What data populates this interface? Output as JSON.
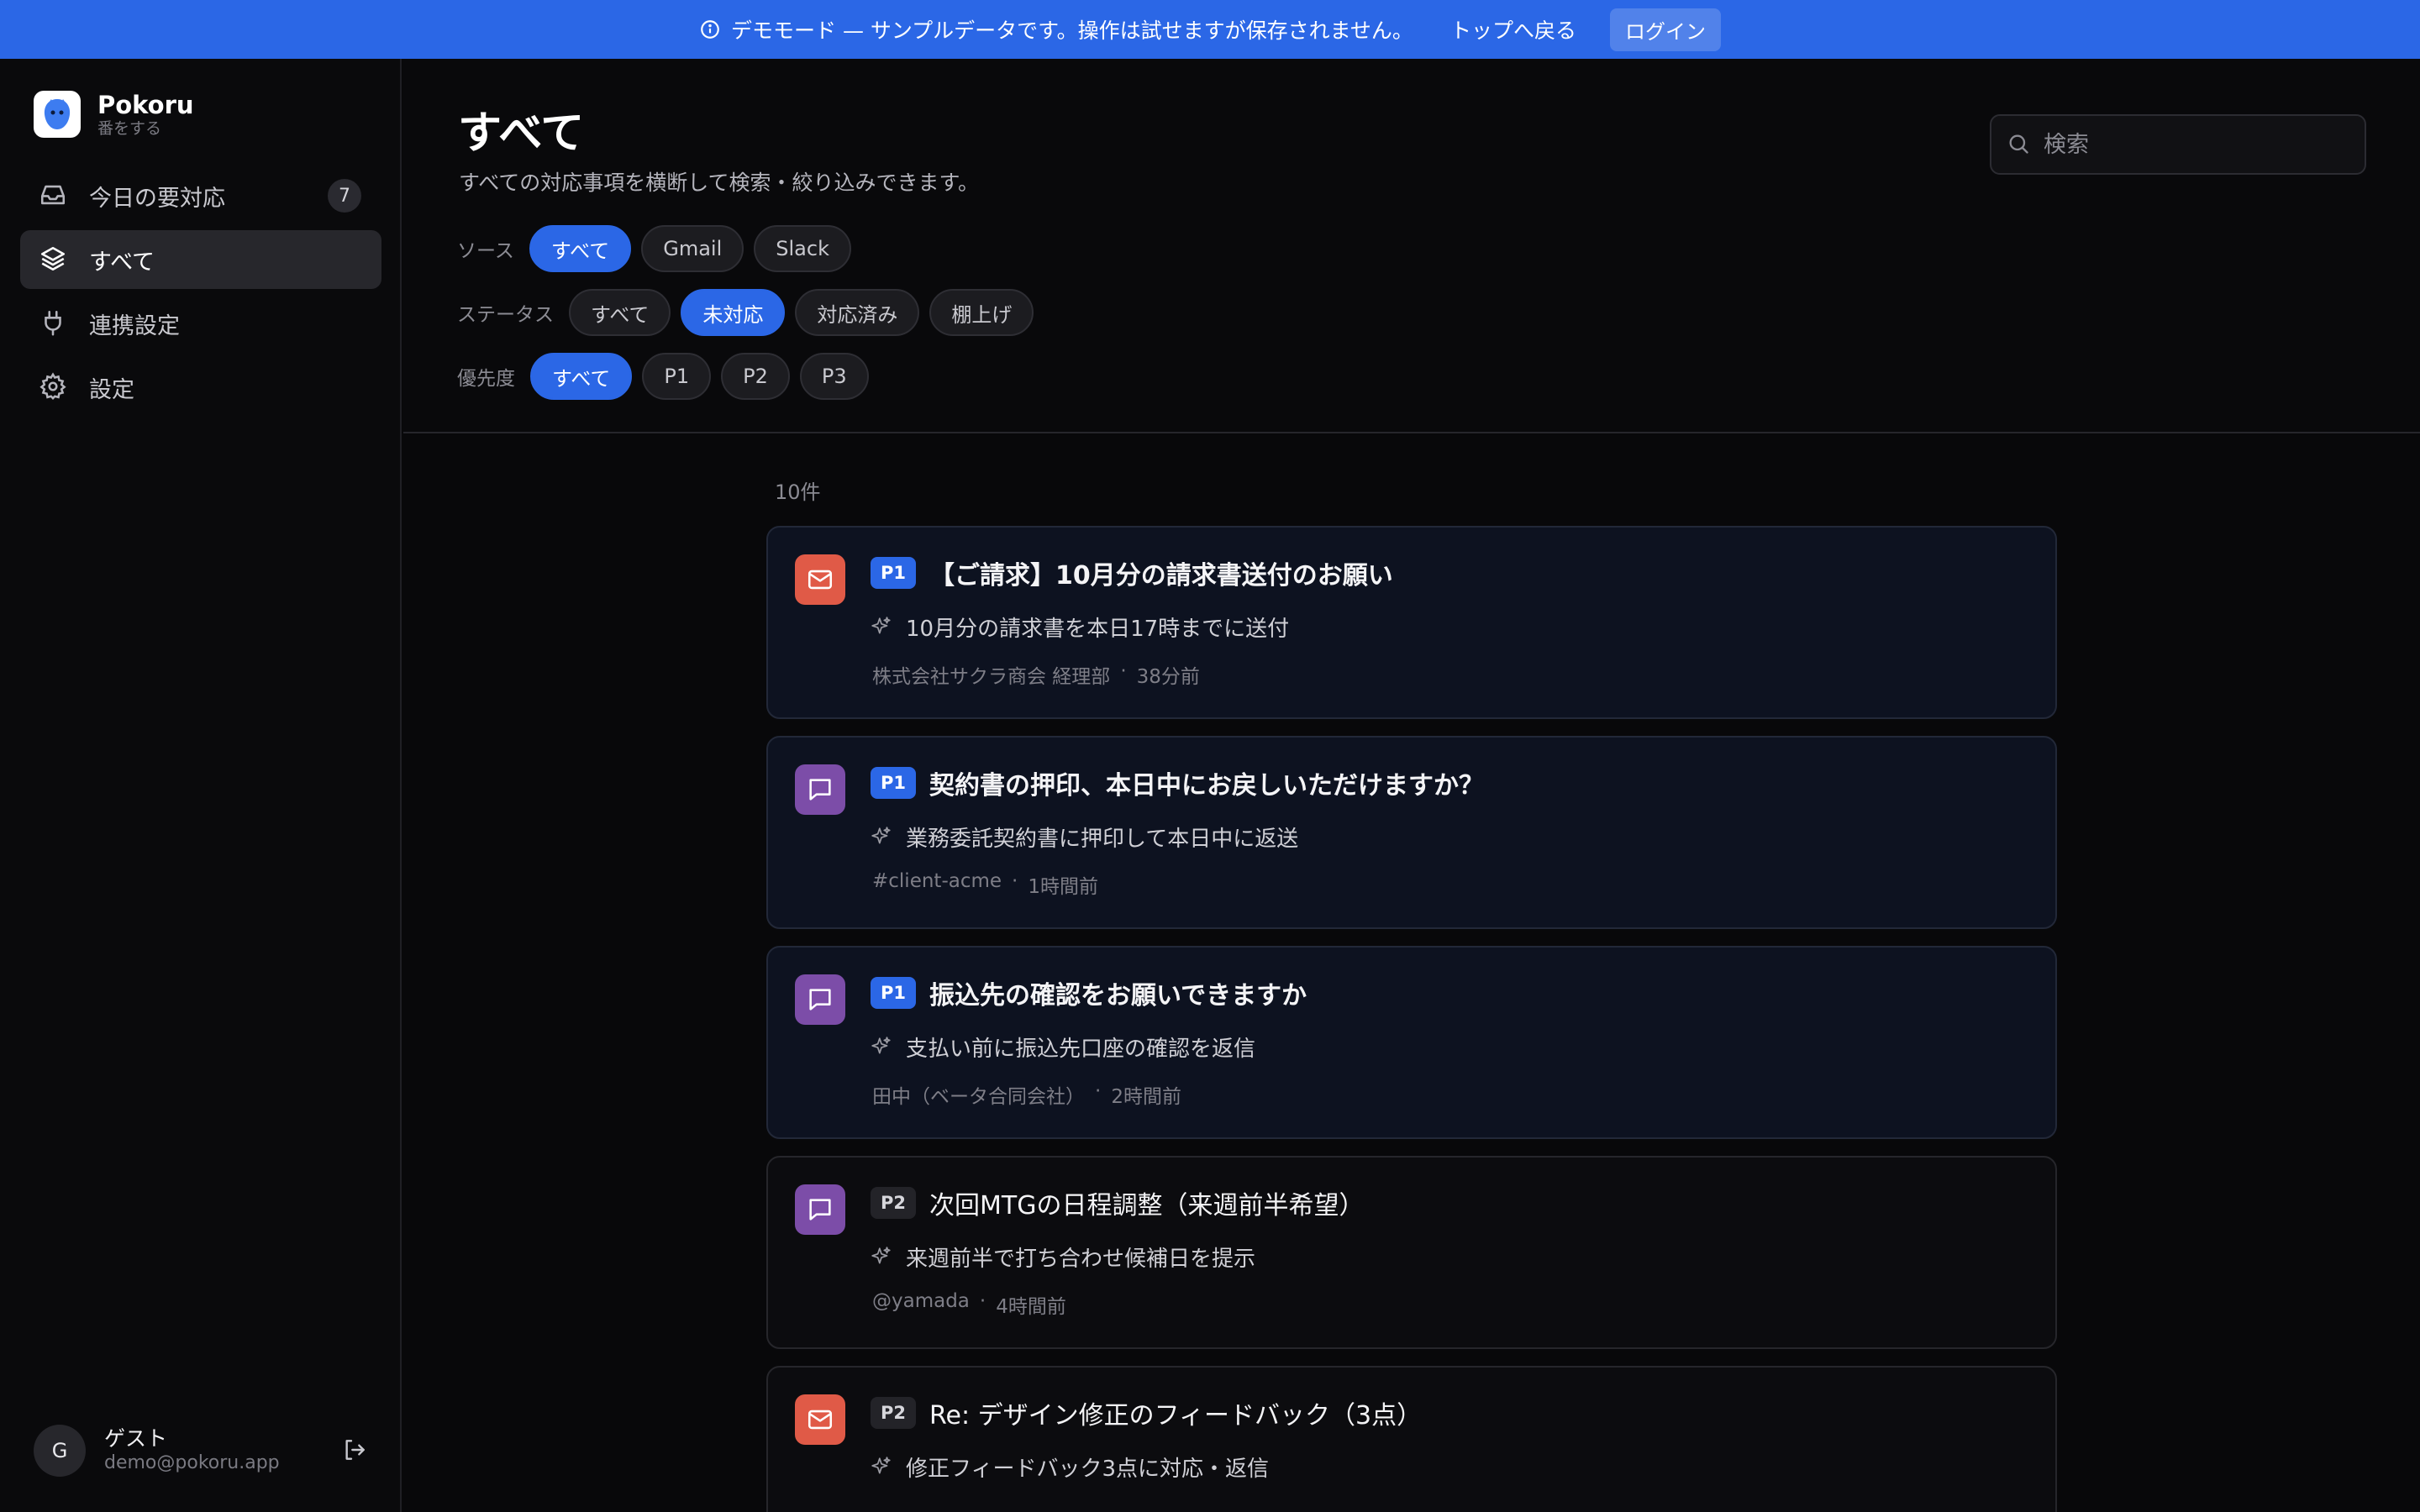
{
  "banner": {
    "text": "デモモード — サンプルデータです。操作は試せますが保存されません。",
    "back_link": "トップへ戻る",
    "login": "ログイン",
    "color": "#2b67e6"
  },
  "sidebar": {
    "brand_name": "Pokoru",
    "brand_tag": "番をする",
    "items": [
      {
        "label": "今日の要対応",
        "icon": "inbox-icon",
        "badge": "7"
      },
      {
        "label": "すべて",
        "icon": "layers-icon",
        "active": true
      },
      {
        "label": "連携設定",
        "icon": "plug-icon"
      },
      {
        "label": "設定",
        "icon": "gear-icon"
      }
    ],
    "user": {
      "initial": "G",
      "name": "ゲスト",
      "email": "demo@pokoru.app"
    }
  },
  "header": {
    "title": "すべて",
    "subtitle": "すべての対応事項を横断して検索・絞り込みできます。",
    "search_placeholder": "検索"
  },
  "filters": {
    "source": {
      "label": "ソース",
      "options": [
        "すべて",
        "Gmail",
        "Slack"
      ],
      "selected": "すべて"
    },
    "status": {
      "label": "ステータス",
      "options": [
        "すべて",
        "未対応",
        "対応済み",
        "棚上げ"
      ],
      "selected": "未対応"
    },
    "priority": {
      "label": "優先度",
      "options": [
        "すべて",
        "P1",
        "P2",
        "P3"
      ],
      "selected": "すべて"
    }
  },
  "list": {
    "count": "10件",
    "items": [
      {
        "source": "mail",
        "priority": "P1",
        "title": "【ご請求】10月分の請求書送付のお願い",
        "action": "10月分の請求書を本日17時までに送付",
        "from": "株式会社サクラ商会 経理部",
        "time": "38分前"
      },
      {
        "source": "chat",
        "priority": "P1",
        "title": "契約書の押印、本日中にお戻しいただけますか？",
        "action": "業務委託契約書に押印して本日中に返送",
        "from": "#client-acme",
        "time": "1時間前"
      },
      {
        "source": "chat",
        "priority": "P1",
        "title": "振込先の確認をお願いできますか",
        "action": "支払い前に振込先口座の確認を返信",
        "from": "田中（ベータ合同会社）",
        "time": "2時間前"
      },
      {
        "source": "chat",
        "priority": "P2",
        "title": "次回MTGの日程調整（来週前半希望）",
        "action": "来週前半で打ち合わせ候補日を提示",
        "from": "@yamada",
        "time": "4時間前"
      },
      {
        "source": "mail",
        "priority": "P2",
        "title": "Re: デザイン修正のフィードバック（3点）",
        "action": "修正フィードバック3点に対応・返信",
        "from": "",
        "time": ""
      }
    ]
  }
}
